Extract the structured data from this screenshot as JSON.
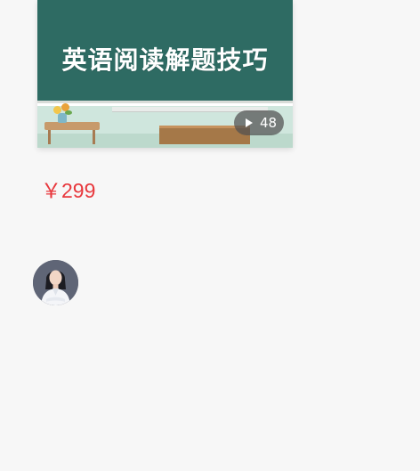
{
  "course": {
    "title": "英语阅读解题技巧",
    "video_count": "48",
    "price": "￥299",
    "colors": {
      "board": "#2e6b63",
      "price": "#e8383d"
    }
  },
  "icons": {
    "play": "play-icon",
    "avatar": "teacher-avatar"
  }
}
